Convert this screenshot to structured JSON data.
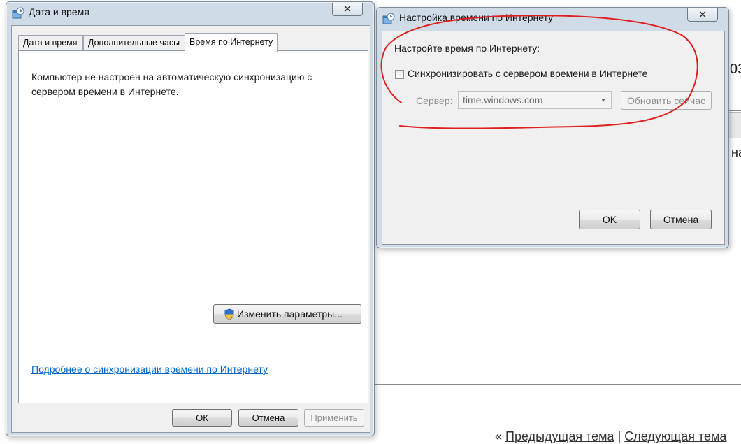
{
  "background": {
    "footer_prev": "Предыдущая тема",
    "footer_separator": "|",
    "footer_next": "Следующая тема",
    "footer_prefix": "«",
    "edge_text_1": "03",
    "edge_text_2": "на"
  },
  "main_dialog": {
    "title": "Дата и время",
    "tabs": [
      "Дата и время",
      "Дополнительные часы",
      "Время по Интернету"
    ],
    "active_tab_index": 2,
    "status_text": "Компьютер не настроен на автоматическую синхронизацию с сервером времени в Интернете.",
    "change_button": "Изменить параметры...",
    "link_text": "Подробнее о синхронизации времени по Интернету",
    "ok_button": "ОК",
    "cancel_button": "Отмена",
    "apply_button": "Применить"
  },
  "internet_time_dialog": {
    "title": "Настройка времени по Интернету",
    "heading": "Настройте время по Интернету:",
    "sync_checkbox_label": "Синхронизировать с сервером времени в Интернете",
    "sync_checked": false,
    "server_label": "Сервер:",
    "server_value": "time.windows.com",
    "update_now_button": "Обновить сейчас",
    "ok_button": "OK",
    "cancel_button": "Отмена"
  },
  "colors": {
    "annotation_stroke": "#e02020",
    "link": "#0066cc",
    "window_frame": "#cfdbe7",
    "dialog_face": "#f0f0f0"
  }
}
